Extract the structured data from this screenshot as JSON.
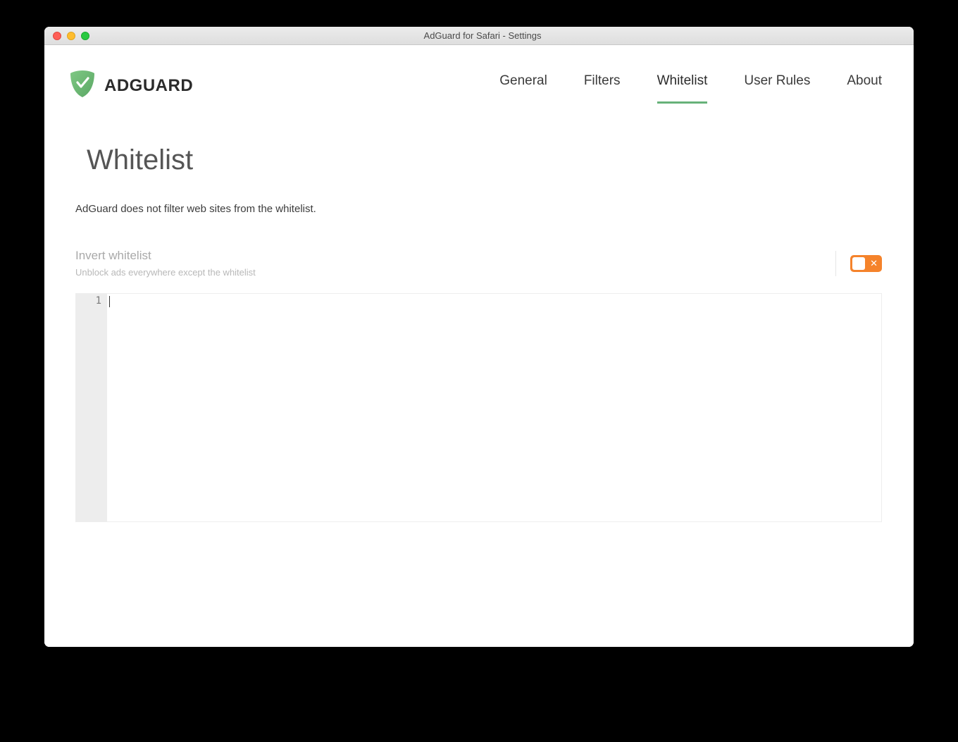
{
  "window": {
    "title": "AdGuard for Safari - Settings"
  },
  "header": {
    "brand": "ADGUARD",
    "tabs": [
      {
        "label": "General",
        "active": false
      },
      {
        "label": "Filters",
        "active": false
      },
      {
        "label": "Whitelist",
        "active": true
      },
      {
        "label": "User Rules",
        "active": false
      },
      {
        "label": "About",
        "active": false
      }
    ]
  },
  "page": {
    "title": "Whitelist",
    "description": "AdGuard does not filter web sites from the whitelist."
  },
  "settings": {
    "invert": {
      "title": "Invert whitelist",
      "subtitle": "Unblock ads everywhere except the whitelist",
      "enabled": false
    }
  },
  "editor": {
    "line_number": "1",
    "content": ""
  },
  "colors": {
    "accent_green": "#67b279",
    "accent_orange": "#f5832b"
  }
}
